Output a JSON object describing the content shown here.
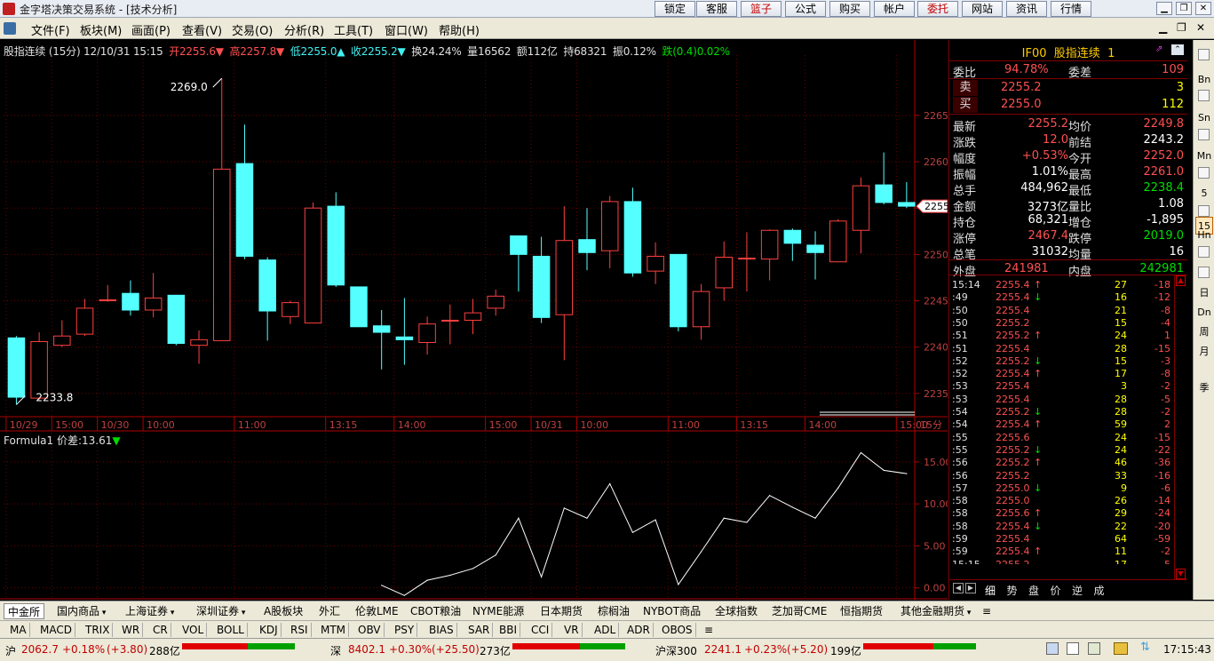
{
  "window": {
    "title": "金字塔决策交易系统 - [技术分析]",
    "top_buttons": [
      {
        "label": "锁定",
        "red": false
      },
      {
        "label": "客服",
        "red": false
      },
      {
        "label": "篮子",
        "red": true
      },
      {
        "label": "公式",
        "red": false
      },
      {
        "label": "购买",
        "red": false
      },
      {
        "label": "帐户",
        "red": false
      },
      {
        "label": "委托",
        "red": true
      },
      {
        "label": "网站",
        "red": false
      },
      {
        "label": "资讯",
        "red": false
      },
      {
        "label": "行情",
        "red": false
      }
    ]
  },
  "menu": [
    "文件(F)",
    "板块(M)",
    "画面(P)",
    "查看(V)",
    "交易(O)",
    "分析(R)",
    "工具(T)",
    "窗口(W)",
    "帮助(H)"
  ],
  "infoline": {
    "name": "股指连续 (15分) 12/10/31 15:15",
    "open": "开2255.6▼",
    "high": "高2257.8▼",
    "low": "低2255.0▲",
    "close": "收2255.2▼",
    "turnover": "换24.24%",
    "volume": "量16562",
    "amount": "额112亿",
    "hold": "持68321",
    "amp": "振0.12%",
    "change": "跌(0.4)0.02%"
  },
  "formula_label": "Formula1 价差:13.61",
  "formula_arrow": "▼",
  "candle_annotations": {
    "high": "2269.0",
    "low": "2233.8",
    "current": "2255"
  },
  "interval_label": "15分",
  "chart_data": [
    {
      "type": "candlestick",
      "title": "股指连续 (15分)",
      "price_axis": [
        "2265",
        "2260",
        "2255",
        "2250",
        "2245",
        "2240",
        "2235"
      ],
      "ylim": [
        2232.5,
        2271.5
      ],
      "time_axis": [
        {
          "label": "10/29",
          "i": 0
        },
        {
          "label": "15:00",
          "i": 2
        },
        {
          "label": "10/30",
          "i": 4
        },
        {
          "label": "10:00",
          "i": 6
        },
        {
          "label": "11:00",
          "i": 10
        },
        {
          "label": "13:15",
          "i": 14
        },
        {
          "label": "14:00",
          "i": 17
        },
        {
          "label": "15:00",
          "i": 21
        },
        {
          "label": "10/31",
          "i": 23
        },
        {
          "label": "10:00",
          "i": 25
        },
        {
          "label": "11:00",
          "i": 29
        },
        {
          "label": "13:15",
          "i": 32
        },
        {
          "label": "14:00",
          "i": 35
        },
        {
          "label": "15:00",
          "i": 39
        }
      ],
      "candles": [
        {
          "o": 2241.0,
          "h": 2241.2,
          "l": 2233.8,
          "c": 2234.6
        },
        {
          "o": 2234.5,
          "h": 2241.6,
          "l": 2234.3,
          "c": 2240.6
        },
        {
          "o": 2240.2,
          "h": 2242.9,
          "l": 2240.0,
          "c": 2241.2
        },
        {
          "o": 2241.4,
          "h": 2245.2,
          "l": 2241.2,
          "c": 2244.2
        },
        {
          "o": 2245.0,
          "h": 2246.7,
          "l": 2244.9,
          "c": 2245.1
        },
        {
          "o": 2245.8,
          "h": 2247.2,
          "l": 2243.4,
          "c": 2244.0
        },
        {
          "o": 2244.0,
          "h": 2248.0,
          "l": 2243.2,
          "c": 2245.3
        },
        {
          "o": 2245.6,
          "h": 2245.6,
          "l": 2240.2,
          "c": 2240.4
        },
        {
          "o": 2240.2,
          "h": 2241.8,
          "l": 2238.2,
          "c": 2240.8
        },
        {
          "o": 2240.7,
          "h": 2269.0,
          "l": 2240.7,
          "c": 2259.2
        },
        {
          "o": 2259.8,
          "h": 2264.0,
          "l": 2249.5,
          "c": 2249.8
        },
        {
          "o": 2249.4,
          "h": 2249.7,
          "l": 2240.7,
          "c": 2243.9
        },
        {
          "o": 2243.3,
          "h": 2245.0,
          "l": 2242.5,
          "c": 2244.8
        },
        {
          "o": 2242.6,
          "h": 2255.6,
          "l": 2242.6,
          "c": 2255.0
        },
        {
          "o": 2255.2,
          "h": 2256.7,
          "l": 2246.5,
          "c": 2246.7
        },
        {
          "o": 2246.5,
          "h": 2246.5,
          "l": 2242.2,
          "c": 2242.2
        },
        {
          "o": 2242.3,
          "h": 2244.0,
          "l": 2237.6,
          "c": 2241.6
        },
        {
          "o": 2241.1,
          "h": 2245.3,
          "l": 2238.1,
          "c": 2240.8
        },
        {
          "o": 2240.5,
          "h": 2243.3,
          "l": 2239.2,
          "c": 2242.5
        },
        {
          "o": 2242.9,
          "h": 2244.6,
          "l": 2240.3,
          "c": 2242.9
        },
        {
          "o": 2242.9,
          "h": 2245.2,
          "l": 2241.4,
          "c": 2243.7
        },
        {
          "o": 2244.2,
          "h": 2246.2,
          "l": 2243.4,
          "c": 2245.5
        },
        {
          "o": 2252.0,
          "h": 2252.0,
          "l": 2246.0,
          "c": 2250.0
        },
        {
          "o": 2249.8,
          "h": 2251.9,
          "l": 2242.6,
          "c": 2243.2
        },
        {
          "o": 2243.5,
          "h": 2255.2,
          "l": 2238.6,
          "c": 2251.5
        },
        {
          "o": 2251.6,
          "h": 2255.0,
          "l": 2248.3,
          "c": 2250.2
        },
        {
          "o": 2250.4,
          "h": 2256.3,
          "l": 2248.5,
          "c": 2255.7
        },
        {
          "o": 2255.7,
          "h": 2257.2,
          "l": 2247.6,
          "c": 2248.0
        },
        {
          "o": 2248.2,
          "h": 2251.3,
          "l": 2246.8,
          "c": 2249.8
        },
        {
          "o": 2250.0,
          "h": 2250.0,
          "l": 2241.7,
          "c": 2242.2
        },
        {
          "o": 2242.2,
          "h": 2246.8,
          "l": 2240.8,
          "c": 2246.0
        },
        {
          "o": 2246.4,
          "h": 2251.4,
          "l": 2245.0,
          "c": 2249.7
        },
        {
          "o": 2249.6,
          "h": 2252.4,
          "l": 2246.0,
          "c": 2249.6
        },
        {
          "o": 2249.5,
          "h": 2252.7,
          "l": 2247.2,
          "c": 2252.6
        },
        {
          "o": 2252.6,
          "h": 2252.8,
          "l": 2249.3,
          "c": 2251.2
        },
        {
          "o": 2251.0,
          "h": 2252.5,
          "l": 2247.3,
          "c": 2250.2
        },
        {
          "o": 2249.2,
          "h": 2253.8,
          "l": 2249.2,
          "c": 2253.6
        },
        {
          "o": 2252.6,
          "h": 2258.3,
          "l": 2250.1,
          "c": 2257.4
        },
        {
          "o": 2257.5,
          "h": 2261.0,
          "l": 2255.4,
          "c": 2255.6
        },
        {
          "o": 2255.6,
          "h": 2257.8,
          "l": 2255.0,
          "c": 2255.2
        }
      ]
    },
    {
      "type": "line",
      "title": "Formula1 价差",
      "y_axis": [
        "15.00",
        "10.00",
        "5.00",
        "0.00"
      ],
      "ylim": [
        -1.2,
        17.0
      ],
      "x_start_index": 16,
      "values": [
        0.3,
        -0.9,
        0.9,
        1.5,
        2.3,
        3.9,
        8.3,
        1.3,
        9.5,
        8.3,
        12.4,
        6.6,
        8.1,
        0.4,
        4.3,
        8.3,
        7.8,
        11.0,
        9.6,
        8.3,
        11.9,
        16.1,
        14.0,
        13.6
      ]
    }
  ],
  "side": {
    "symbol": "IF00",
    "name": "股指连续",
    "num": "1",
    "weibi_label": "委比",
    "weibi": "94.78%",
    "weicha_label": "委差",
    "weicha": "109",
    "sell_label": "卖",
    "sell_price": "2255.2",
    "sell_vol": "3",
    "buy_label": "买",
    "buy_price": "2255.0",
    "buy_vol": "112",
    "rows": [
      {
        "l1": "最新",
        "v1": "2255.2",
        "c1": "#ff5050",
        "l2": "均价",
        "v2": "2249.8",
        "c2": "#ff5050"
      },
      {
        "l1": "涨跌",
        "v1": "12.0",
        "c1": "#ff5050",
        "l2": "前结",
        "v2": "2243.2",
        "c2": "#ffffff"
      },
      {
        "l1": "幅度",
        "v1": "+0.53%",
        "c1": "#ff5050",
        "l2": "今开",
        "v2": "2252.0",
        "c2": "#ff5050"
      },
      {
        "l1": "振幅",
        "v1": "1.01%",
        "c1": "#ffffff",
        "l2": "最高",
        "v2": "2261.0",
        "c2": "#ff5050"
      },
      {
        "l1": "总手",
        "v1": "484,962",
        "c1": "#ffffff",
        "l2": "最低",
        "v2": "2238.4",
        "c2": "#00dd00"
      },
      {
        "l1": "金额",
        "v1": "3273亿",
        "c1": "#ffffff",
        "l2": "量比",
        "v2": "1.08",
        "c2": "#ffffff"
      },
      {
        "l1": "持仓",
        "v1": "68,321",
        "c1": "#ffffff",
        "l2": "增仓",
        "v2": "-1,895",
        "c2": "#ffffff"
      },
      {
        "l1": "涨停",
        "v1": "2467.4",
        "c1": "#ff5050",
        "l2": "跌停",
        "v2": "2019.0",
        "c2": "#00dd00"
      },
      {
        "l1": "总笔",
        "v1": "31032",
        "c1": "#ffffff",
        "l2": "均量",
        "v2": "16",
        "c2": "#ffffff"
      }
    ],
    "outer_label": "外盘",
    "outer": "241981",
    "inner_label": "内盘",
    "inner": "242981",
    "ticks": [
      {
        "t": "15:14",
        "p": "2255.4",
        "a": "↑",
        "v": "27",
        "d": "-18"
      },
      {
        "t": ":49",
        "p": "2255.4",
        "a": "↓",
        "v": "16",
        "d": "-12"
      },
      {
        "t": ":50",
        "p": "2255.4",
        "a": "",
        "v": "21",
        "d": "-8"
      },
      {
        "t": ":50",
        "p": "2255.2",
        "a": "",
        "v": "15",
        "d": "-4"
      },
      {
        "t": ":51",
        "p": "2255.2",
        "a": "↑",
        "v": "24",
        "d": "1"
      },
      {
        "t": ":51",
        "p": "2255.4",
        "a": "",
        "v": "28",
        "d": "-15"
      },
      {
        "t": ":52",
        "p": "2255.2",
        "a": "↓",
        "v": "15",
        "d": "-3"
      },
      {
        "t": ":52",
        "p": "2255.4",
        "a": "↑",
        "v": "17",
        "d": "-8"
      },
      {
        "t": ":53",
        "p": "2255.4",
        "a": "",
        "v": "3",
        "d": "-2"
      },
      {
        "t": ":53",
        "p": "2255.4",
        "a": "",
        "v": "28",
        "d": "-5"
      },
      {
        "t": ":54",
        "p": "2255.2",
        "a": "↓",
        "v": "28",
        "d": "-2"
      },
      {
        "t": ":54",
        "p": "2255.4",
        "a": "↑",
        "v": "59",
        "d": "2"
      },
      {
        "t": ":55",
        "p": "2255.6",
        "a": "",
        "v": "24",
        "d": "-15"
      },
      {
        "t": ":55",
        "p": "2255.2",
        "a": "↓",
        "v": "24",
        "d": "-22"
      },
      {
        "t": ":56",
        "p": "2255.2",
        "a": "↑",
        "v": "46",
        "d": "-36"
      },
      {
        "t": ":56",
        "p": "2255.2",
        "a": "",
        "v": "33",
        "d": "-16"
      },
      {
        "t": ":57",
        "p": "2255.0",
        "a": "↓",
        "v": "9",
        "d": "-6"
      },
      {
        "t": ":58",
        "p": "2255.0",
        "a": "",
        "v": "26",
        "d": "-14"
      },
      {
        "t": ":58",
        "p": "2255.6",
        "a": "↑",
        "v": "29",
        "d": "-24"
      },
      {
        "t": ":58",
        "p": "2255.4",
        "a": "↓",
        "v": "22",
        "d": "-20"
      },
      {
        "t": ":59",
        "p": "2255.4",
        "a": "",
        "v": "64",
        "d": "-59"
      },
      {
        "t": ":59",
        "p": "2255.4",
        "a": "↑",
        "v": "11",
        "d": "-2"
      },
      {
        "t": "15:15",
        "p": "2255.2",
        "a": "",
        "v": "17",
        "d": "-5"
      }
    ],
    "tabs": [
      "细",
      "势",
      "盘",
      "价",
      "逆",
      "成"
    ]
  },
  "right_toolbar": [
    "Bn",
    "Sn",
    "Mn",
    "5",
    "15",
    "Hn",
    "日",
    "Dn",
    "周",
    "月",
    "季"
  ],
  "bottom_tabs": [
    {
      "label": "中金所",
      "arrow": false
    },
    {
      "label": "国内商品",
      "arrow": true
    },
    {
      "label": "上海证券",
      "arrow": true
    },
    {
      "label": "深圳证券",
      "arrow": true
    },
    {
      "label": "A股板块",
      "arrow": false
    },
    {
      "label": "外汇",
      "arrow": false
    },
    {
      "label": "伦敦LME",
      "arrow": false
    },
    {
      "label": "CBOT粮油",
      "arrow": false
    },
    {
      "label": "NYME能源",
      "arrow": false
    },
    {
      "label": "日本期货",
      "arrow": false
    },
    {
      "label": "棕榈油",
      "arrow": false
    },
    {
      "label": "NYBOT商品",
      "arrow": false
    },
    {
      "label": "全球指数",
      "arrow": false
    },
    {
      "label": "芝加哥CME",
      "arrow": false
    },
    {
      "label": "恒指期货",
      "arrow": false
    },
    {
      "label": "其他金融期货",
      "arrow": true
    }
  ],
  "indicators": [
    "MA",
    "MACD",
    "TRIX",
    "WR",
    "CR",
    "VOL",
    "BOLL",
    "KDJ",
    "RSI",
    "MTM",
    "OBV",
    "PSY",
    "BIAS",
    "SAR",
    "BBI",
    "CCI",
    "VR",
    "ADL",
    "ADR",
    "OBOS"
  ],
  "status": {
    "sh_label": "沪",
    "sh_val": "2062.7",
    "sh_chg": "+0.18%",
    "sh_diff": "(+3.80)",
    "sh_amt": "288亿",
    "sz_label": "深",
    "sz_val": "8402.1",
    "sz_chg": "+0.30%",
    "sz_diff": "(+25.50)",
    "sz_amt": "273亿",
    "hs_label": "沪深300",
    "hs_val": "2241.1",
    "hs_chg": "+0.23%",
    "hs_diff": "(+5.20)",
    "hs_amt": "199亿",
    "time": "17:15:43"
  }
}
